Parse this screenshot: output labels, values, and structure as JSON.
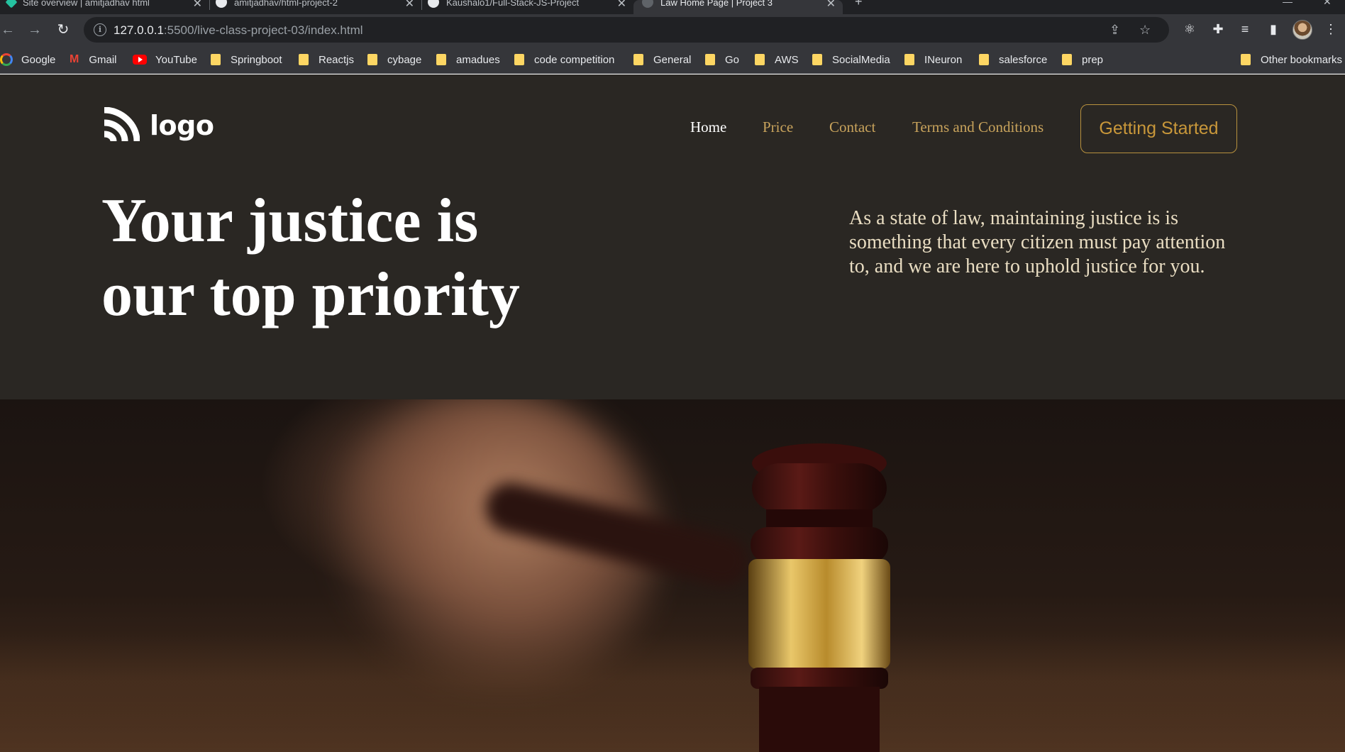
{
  "browser": {
    "tabs": [
      {
        "title": "Site overview | amitjadhav html"
      },
      {
        "title": "amitjadhav/html-project-2"
      },
      {
        "title": "Kaushalo1/Full-Stack-JS-Project"
      },
      {
        "title": "Law Home Page | Project 3"
      }
    ],
    "url": {
      "host": "127.0.0.1",
      "path": ":5500/live-class-project-03/index.html"
    },
    "bookmarks": [
      {
        "label": "Google",
        "icon": "google-icon"
      },
      {
        "label": "Gmail",
        "icon": "gmail-icon"
      },
      {
        "label": "YouTube",
        "icon": "youtube-icon"
      },
      {
        "label": "Springboot",
        "icon": "folder-icon"
      },
      {
        "label": "Reactjs",
        "icon": "folder-icon"
      },
      {
        "label": "cybage",
        "icon": "folder-icon"
      },
      {
        "label": "amadues",
        "icon": "folder-icon"
      },
      {
        "label": "code competition",
        "icon": "folder-icon"
      },
      {
        "label": "General",
        "icon": "folder-icon"
      },
      {
        "label": "Go",
        "icon": "folder-icon"
      },
      {
        "label": "AWS",
        "icon": "folder-icon"
      },
      {
        "label": "SocialMedia",
        "icon": "folder-icon"
      },
      {
        "label": "INeuron",
        "icon": "folder-icon"
      },
      {
        "label": "salesforce",
        "icon": "folder-icon"
      },
      {
        "label": "prep",
        "icon": "folder-icon"
      }
    ],
    "other_bookmarks": "Other bookmarks"
  },
  "site": {
    "logo_text": "logo",
    "nav": [
      {
        "label": "Home",
        "active": true
      },
      {
        "label": "Price",
        "active": false
      },
      {
        "label": "Contact",
        "active": false
      },
      {
        "label": "Terms and Conditions",
        "active": false
      }
    ],
    "cta_label": "Getting Started",
    "hero_title_line1": "Your justice is",
    "hero_title_line2": "our top priority",
    "hero_subtitle": "As a state of law, maintaining justice is is something that every citizen must pay attention to, and we are here to uphold justice for you.",
    "colors": {
      "background": "#2a2723",
      "accent": "#c8973a",
      "nav_link": "#c8a35c",
      "heading": "#ffffff",
      "subtitle": "#e9ddc2"
    }
  }
}
